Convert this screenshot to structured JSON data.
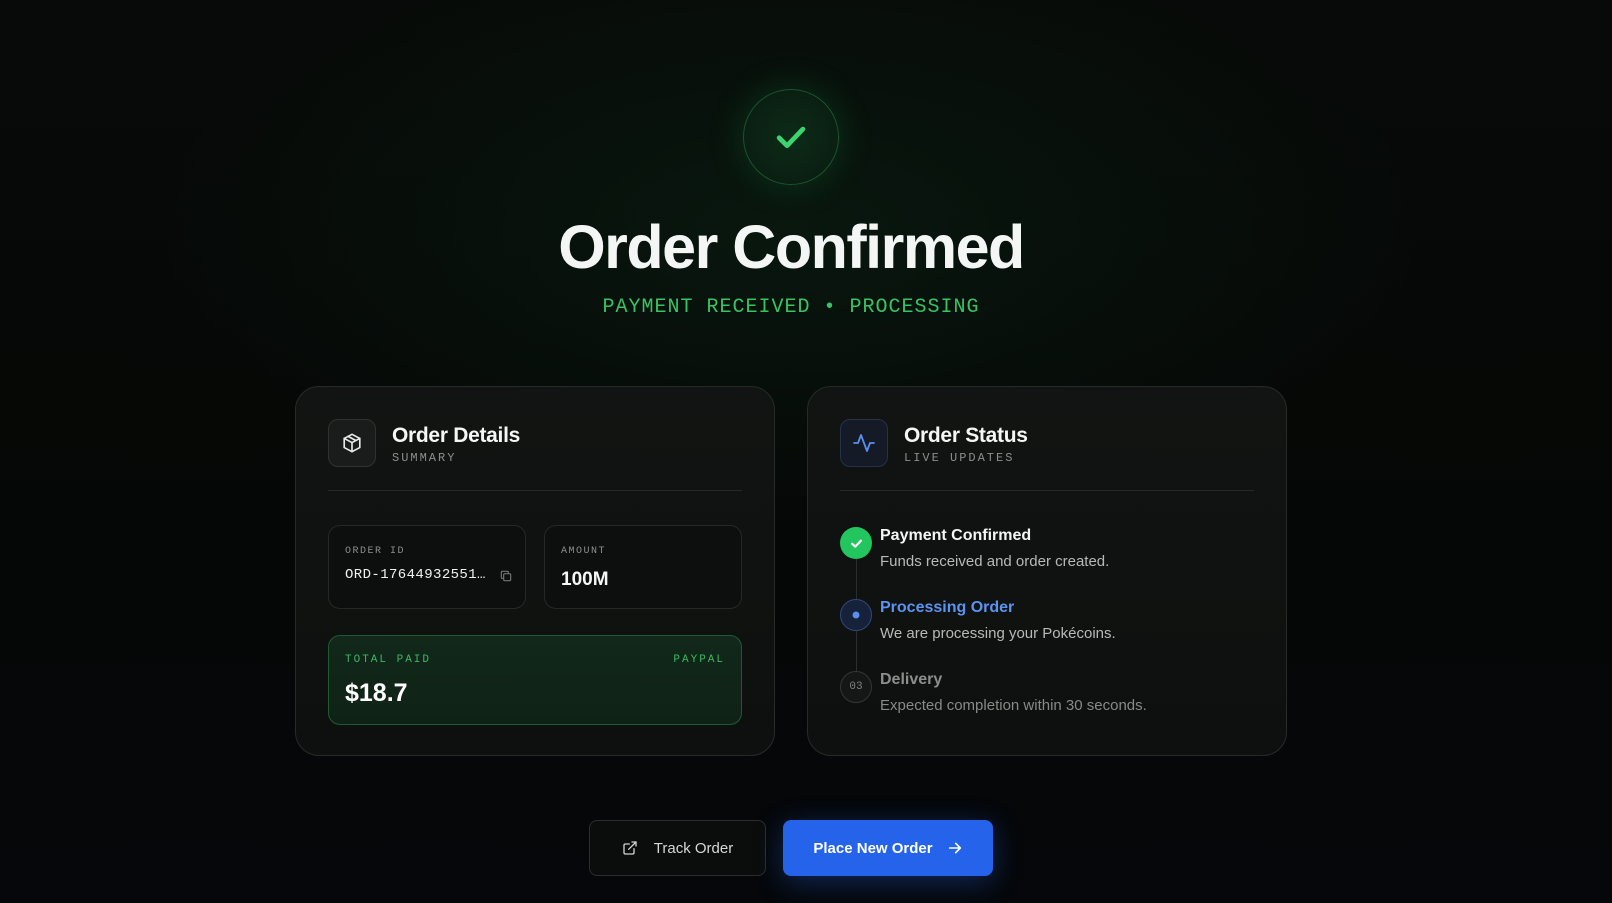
{
  "hero": {
    "title": "Order Confirmed",
    "subtitle": "PAYMENT RECEIVED • PROCESSING",
    "icon": "check-icon",
    "accent": "#22c55e"
  },
  "order_details": {
    "title": "Order Details",
    "subtitle": "SUMMARY",
    "icon": "package-icon",
    "order_id_label": "ORDER ID",
    "order_id_value": "ORD-17644932551…",
    "amount_label": "AMOUNT",
    "amount_value": "100M",
    "total_label": "TOTAL PAID",
    "payment_method": "PAYPAL",
    "total_value": "$18.7"
  },
  "order_status": {
    "title": "Order Status",
    "subtitle": "LIVE UPDATES",
    "icon": "activity-icon",
    "steps": [
      {
        "title": "Payment Confirmed",
        "description": "Funds received and order created.",
        "state": "done"
      },
      {
        "title": "Processing Order",
        "description": "We are processing your Pokécoins.",
        "state": "active"
      },
      {
        "title": "Delivery",
        "description": "Expected completion within 30 seconds.",
        "state": "pending",
        "number": "03"
      }
    ]
  },
  "actions": {
    "track_label": "Track Order",
    "new_order_label": "Place New Order",
    "primary_color": "#2563eb"
  }
}
